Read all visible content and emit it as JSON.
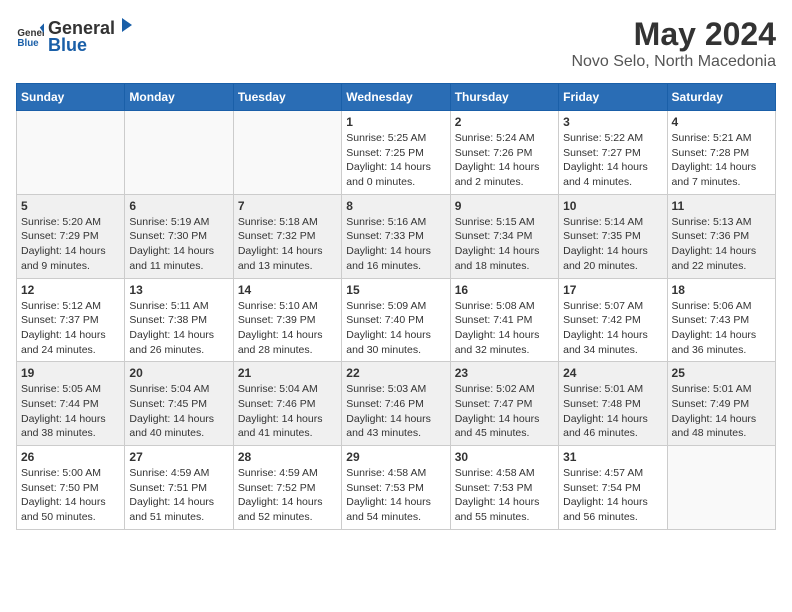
{
  "header": {
    "logo_general": "General",
    "logo_blue": "Blue",
    "month_year": "May 2024",
    "location": "Novo Selo, North Macedonia"
  },
  "days_of_week": [
    "Sunday",
    "Monday",
    "Tuesday",
    "Wednesday",
    "Thursday",
    "Friday",
    "Saturday"
  ],
  "weeks": [
    [
      {
        "day": "",
        "info": ""
      },
      {
        "day": "",
        "info": ""
      },
      {
        "day": "",
        "info": ""
      },
      {
        "day": "1",
        "info": "Sunrise: 5:25 AM\nSunset: 7:25 PM\nDaylight: 14 hours\nand 0 minutes."
      },
      {
        "day": "2",
        "info": "Sunrise: 5:24 AM\nSunset: 7:26 PM\nDaylight: 14 hours\nand 2 minutes."
      },
      {
        "day": "3",
        "info": "Sunrise: 5:22 AM\nSunset: 7:27 PM\nDaylight: 14 hours\nand 4 minutes."
      },
      {
        "day": "4",
        "info": "Sunrise: 5:21 AM\nSunset: 7:28 PM\nDaylight: 14 hours\nand 7 minutes."
      }
    ],
    [
      {
        "day": "5",
        "info": "Sunrise: 5:20 AM\nSunset: 7:29 PM\nDaylight: 14 hours\nand 9 minutes."
      },
      {
        "day": "6",
        "info": "Sunrise: 5:19 AM\nSunset: 7:30 PM\nDaylight: 14 hours\nand 11 minutes."
      },
      {
        "day": "7",
        "info": "Sunrise: 5:18 AM\nSunset: 7:32 PM\nDaylight: 14 hours\nand 13 minutes."
      },
      {
        "day": "8",
        "info": "Sunrise: 5:16 AM\nSunset: 7:33 PM\nDaylight: 14 hours\nand 16 minutes."
      },
      {
        "day": "9",
        "info": "Sunrise: 5:15 AM\nSunset: 7:34 PM\nDaylight: 14 hours\nand 18 minutes."
      },
      {
        "day": "10",
        "info": "Sunrise: 5:14 AM\nSunset: 7:35 PM\nDaylight: 14 hours\nand 20 minutes."
      },
      {
        "day": "11",
        "info": "Sunrise: 5:13 AM\nSunset: 7:36 PM\nDaylight: 14 hours\nand 22 minutes."
      }
    ],
    [
      {
        "day": "12",
        "info": "Sunrise: 5:12 AM\nSunset: 7:37 PM\nDaylight: 14 hours\nand 24 minutes."
      },
      {
        "day": "13",
        "info": "Sunrise: 5:11 AM\nSunset: 7:38 PM\nDaylight: 14 hours\nand 26 minutes."
      },
      {
        "day": "14",
        "info": "Sunrise: 5:10 AM\nSunset: 7:39 PM\nDaylight: 14 hours\nand 28 minutes."
      },
      {
        "day": "15",
        "info": "Sunrise: 5:09 AM\nSunset: 7:40 PM\nDaylight: 14 hours\nand 30 minutes."
      },
      {
        "day": "16",
        "info": "Sunrise: 5:08 AM\nSunset: 7:41 PM\nDaylight: 14 hours\nand 32 minutes."
      },
      {
        "day": "17",
        "info": "Sunrise: 5:07 AM\nSunset: 7:42 PM\nDaylight: 14 hours\nand 34 minutes."
      },
      {
        "day": "18",
        "info": "Sunrise: 5:06 AM\nSunset: 7:43 PM\nDaylight: 14 hours\nand 36 minutes."
      }
    ],
    [
      {
        "day": "19",
        "info": "Sunrise: 5:05 AM\nSunset: 7:44 PM\nDaylight: 14 hours\nand 38 minutes."
      },
      {
        "day": "20",
        "info": "Sunrise: 5:04 AM\nSunset: 7:45 PM\nDaylight: 14 hours\nand 40 minutes."
      },
      {
        "day": "21",
        "info": "Sunrise: 5:04 AM\nSunset: 7:46 PM\nDaylight: 14 hours\nand 41 minutes."
      },
      {
        "day": "22",
        "info": "Sunrise: 5:03 AM\nSunset: 7:46 PM\nDaylight: 14 hours\nand 43 minutes."
      },
      {
        "day": "23",
        "info": "Sunrise: 5:02 AM\nSunset: 7:47 PM\nDaylight: 14 hours\nand 45 minutes."
      },
      {
        "day": "24",
        "info": "Sunrise: 5:01 AM\nSunset: 7:48 PM\nDaylight: 14 hours\nand 46 minutes."
      },
      {
        "day": "25",
        "info": "Sunrise: 5:01 AM\nSunset: 7:49 PM\nDaylight: 14 hours\nand 48 minutes."
      }
    ],
    [
      {
        "day": "26",
        "info": "Sunrise: 5:00 AM\nSunset: 7:50 PM\nDaylight: 14 hours\nand 50 minutes."
      },
      {
        "day": "27",
        "info": "Sunrise: 4:59 AM\nSunset: 7:51 PM\nDaylight: 14 hours\nand 51 minutes."
      },
      {
        "day": "28",
        "info": "Sunrise: 4:59 AM\nSunset: 7:52 PM\nDaylight: 14 hours\nand 52 minutes."
      },
      {
        "day": "29",
        "info": "Sunrise: 4:58 AM\nSunset: 7:53 PM\nDaylight: 14 hours\nand 54 minutes."
      },
      {
        "day": "30",
        "info": "Sunrise: 4:58 AM\nSunset: 7:53 PM\nDaylight: 14 hours\nand 55 minutes."
      },
      {
        "day": "31",
        "info": "Sunrise: 4:57 AM\nSunset: 7:54 PM\nDaylight: 14 hours\nand 56 minutes."
      },
      {
        "day": "",
        "info": ""
      }
    ]
  ]
}
